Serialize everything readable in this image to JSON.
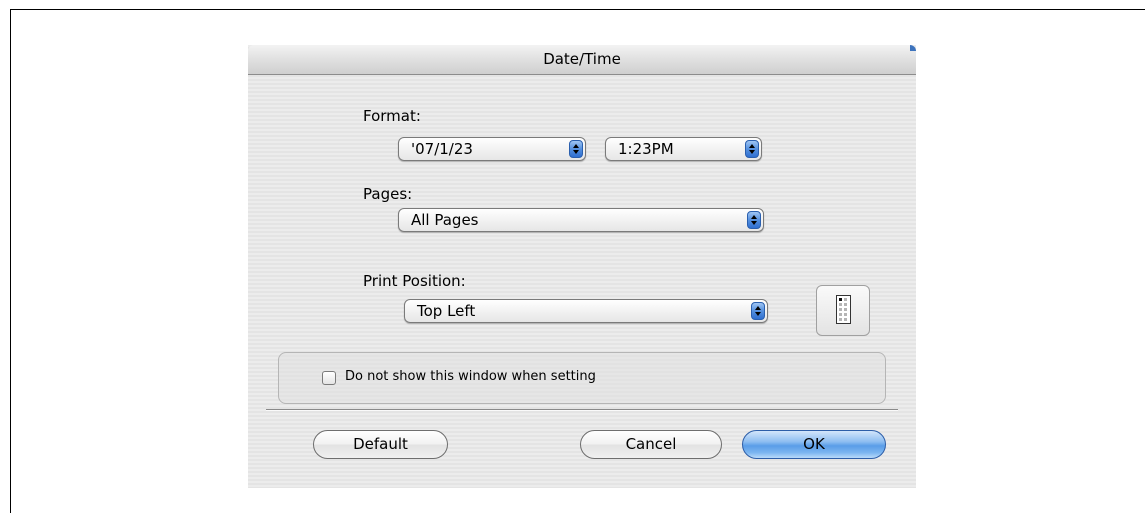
{
  "dialog": {
    "title": "Date/Time",
    "format_label": "Format:",
    "date_format": "'07/1/23",
    "time_format": "1:23PM",
    "pages_label": "Pages:",
    "pages_value": "All Pages",
    "print_position_label": "Print Position:",
    "print_position_value": "Top Left",
    "checkbox_label": "Do not show this window when setting",
    "checkbox_checked": false,
    "default_button": "Default",
    "cancel_button": "Cancel",
    "ok_button": "OK"
  },
  "colors": {
    "accent": "#5a9de8",
    "popup_arrows": "#3a7bd8"
  },
  "icons": {
    "popup_arrows": "up-down-arrows-icon",
    "position_preview": "page-position-icon"
  }
}
